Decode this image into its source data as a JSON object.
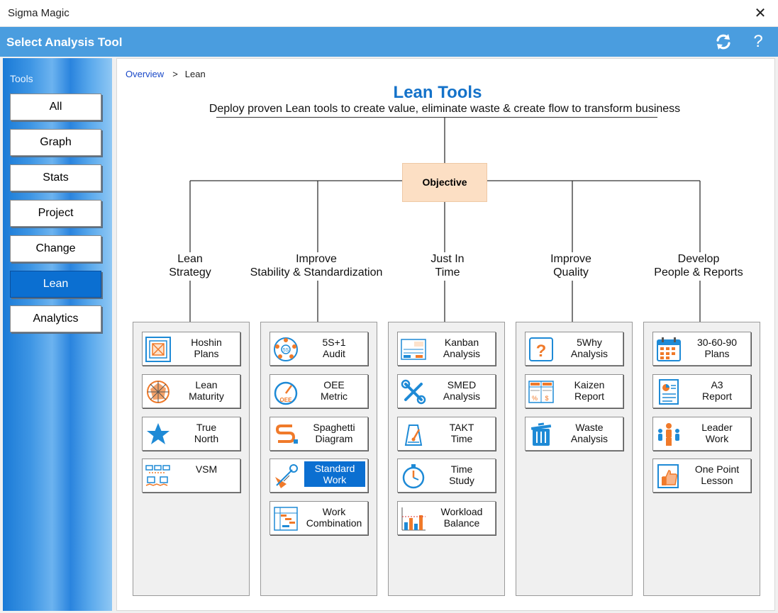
{
  "window": {
    "title": "Sigma Magic"
  },
  "header": {
    "title": "Select Analysis Tool"
  },
  "sidebar": {
    "label": "Tools",
    "items": [
      {
        "label": "All"
      },
      {
        "label": "Graph"
      },
      {
        "label": "Stats"
      },
      {
        "label": "Project"
      },
      {
        "label": "Change"
      },
      {
        "label": "Lean",
        "active": true
      },
      {
        "label": "Analytics"
      }
    ]
  },
  "breadcrumb": {
    "root": "Overview",
    "separator": ">",
    "current": "Lean"
  },
  "main": {
    "title": "Lean Tools",
    "subtitle": "Deploy proven Lean tools to create value, eliminate waste & create flow to transform business",
    "objective": "Objective",
    "branches": [
      {
        "line1": "Lean",
        "line2": "Strategy",
        "tools": [
          {
            "line1": "Hoshin",
            "line2": "Plans",
            "icon": "hoshin-icon"
          },
          {
            "line1": "Lean",
            "line2": "Maturity",
            "icon": "maturity-radar-icon"
          },
          {
            "line1": "True",
            "line2": "North",
            "icon": "star-icon"
          },
          {
            "line1": "VSM",
            "line2": "",
            "icon": "value-stream-map-icon"
          }
        ]
      },
      {
        "line1": "Improve",
        "line2": "Stability & Standardization",
        "tools": [
          {
            "line1": "5S+1",
            "line2": "Audit",
            "icon": "5s-wheel-icon"
          },
          {
            "line1": "OEE",
            "line2": "Metric",
            "icon": "oee-gauge-icon"
          },
          {
            "line1": "Spaghetti",
            "line2": "Diagram",
            "icon": "spaghetti-icon"
          },
          {
            "line1": "Standard",
            "line2": "Work",
            "icon": "standard-work-icon",
            "selected": true
          },
          {
            "line1": "Work",
            "line2": "Combination",
            "icon": "work-combination-icon"
          }
        ]
      },
      {
        "line1": "Just In",
        "line2": "Time",
        "tools": [
          {
            "line1": "Kanban",
            "line2": "Analysis",
            "icon": "kanban-card-icon"
          },
          {
            "line1": "SMED",
            "line2": "Analysis",
            "icon": "tools-wrench-icon"
          },
          {
            "line1": "TAKT",
            "line2": "Time",
            "icon": "takt-icon"
          },
          {
            "line1": "Time",
            "line2": "Study",
            "icon": "stopwatch-icon"
          },
          {
            "line1": "Workload",
            "line2": "Balance",
            "icon": "bar-chart-icon"
          }
        ]
      },
      {
        "line1": "Improve",
        "line2": "Quality",
        "tools": [
          {
            "line1": "5Why",
            "line2": "Analysis",
            "icon": "question-icon"
          },
          {
            "line1": "Kaizen",
            "line2": "Report",
            "icon": "kaizen-report-icon"
          },
          {
            "line1": "Waste",
            "line2": "Analysis",
            "icon": "trash-bin-icon"
          }
        ]
      },
      {
        "line1": "Develop",
        "line2": "People & Reports",
        "tools": [
          {
            "line1": "30-60-90",
            "line2": "Plans",
            "icon": "calendar-icon"
          },
          {
            "line1": "A3",
            "line2": "Report",
            "icon": "a3-report-icon"
          },
          {
            "line1": "Leader",
            "line2": "Work",
            "icon": "leader-icon"
          },
          {
            "line1": "One Point",
            "line2": "Lesson",
            "icon": "thumbs-up-icon"
          }
        ]
      }
    ]
  },
  "colors": {
    "accent": "#4a9ddf",
    "selected": "#0b6fd1",
    "title": "#1472c9",
    "objective_bg": "#fcdfc4",
    "icon_blue": "#1e8ad6",
    "icon_orange": "#f07a2a"
  }
}
